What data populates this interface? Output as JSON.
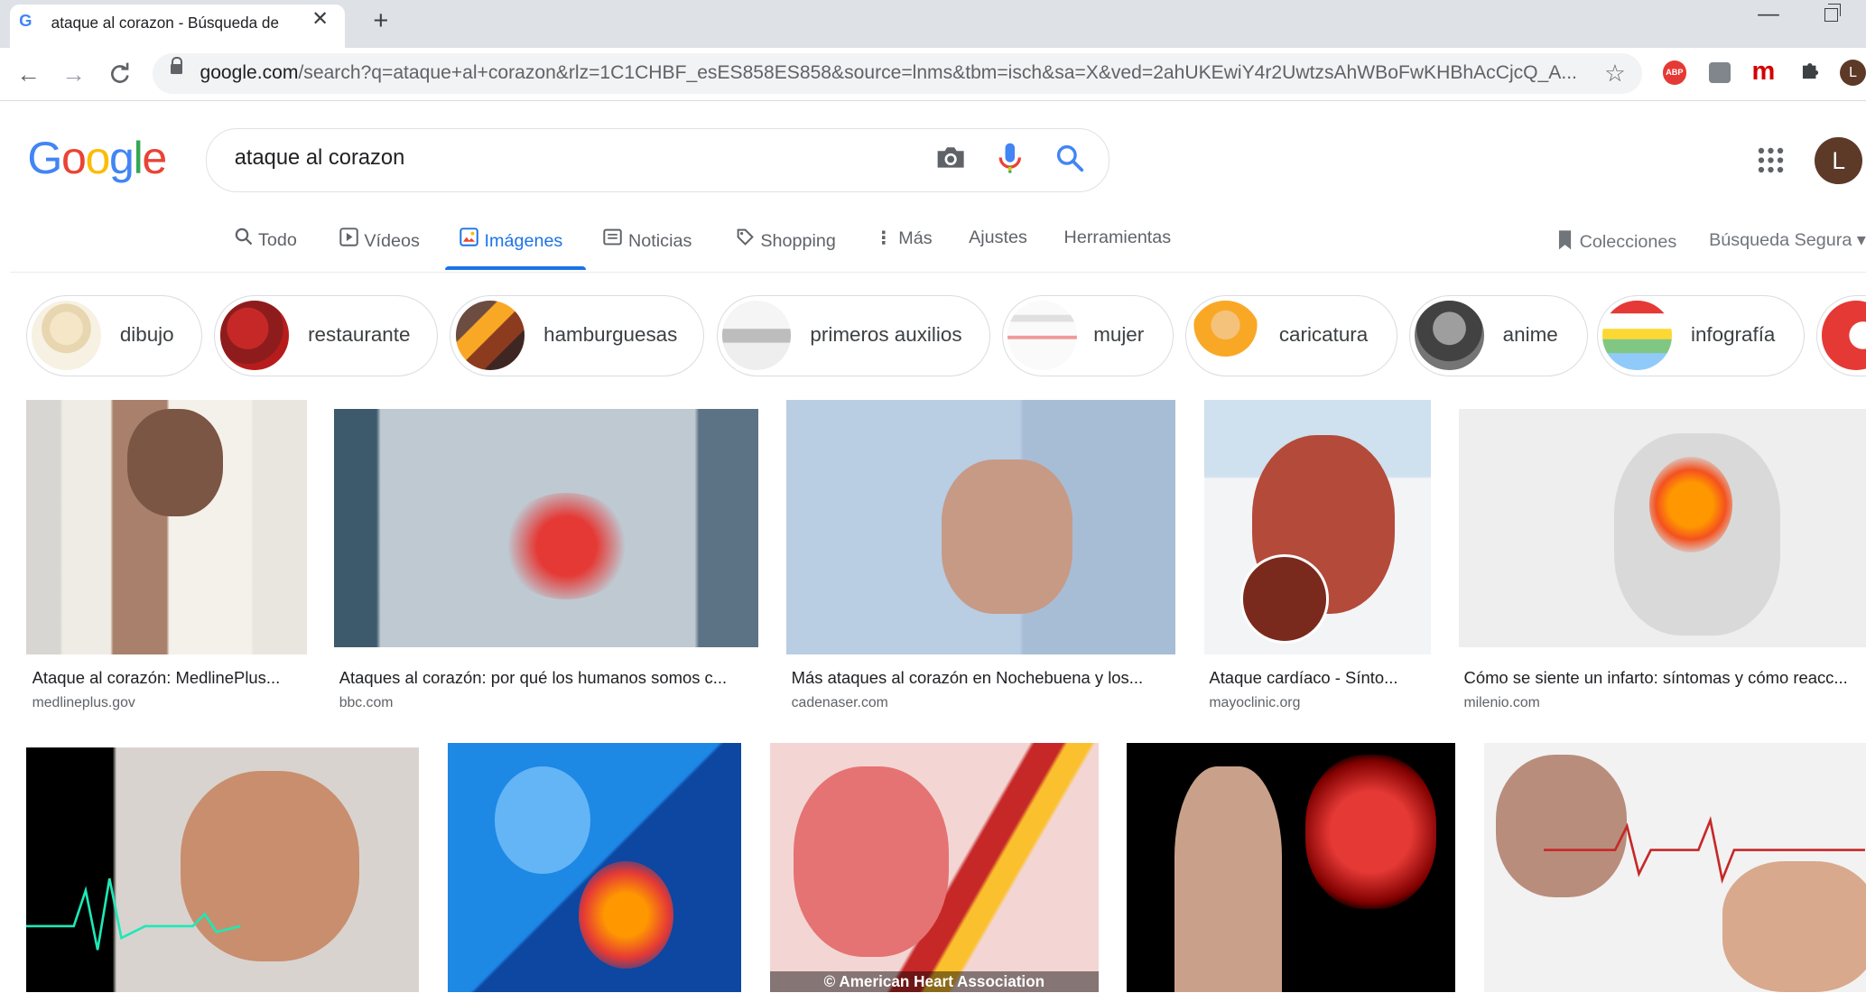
{
  "browser": {
    "tab_title": "ataque al corazon - Búsqueda de",
    "tab_favicon": "G",
    "new_tab": "+",
    "close_tab": "✕",
    "url_domain": "google.com",
    "url_rest": "/search?q=ataque+al+corazon&rlz=1C1CHBF_esES858ES858&source=lnms&tbm=isch&sa=X&ved=2ahUKEwiY4r2UwtzsAhWBoFwKHBhAcCjcQ_A...",
    "profile_initial": "L",
    "extensions": [
      "abp-icon",
      "hat-icon",
      "m-icon",
      "puzzle-icon"
    ]
  },
  "google": {
    "logo": [
      "G",
      "o",
      "o",
      "g",
      "l",
      "e"
    ],
    "logo_colors": [
      "#4285f4",
      "#ea4335",
      "#fbbc05",
      "#4285f4",
      "#34a853",
      "#ea4335"
    ],
    "query": "ataque al corazon",
    "avatar_initial": "L",
    "tabs": [
      {
        "label": "Todo",
        "icon": "search-icon"
      },
      {
        "label": "Vídeos",
        "icon": "play-icon"
      },
      {
        "label": "Imágenes",
        "icon": "image-icon",
        "active": true
      },
      {
        "label": "Noticias",
        "icon": "news-icon"
      },
      {
        "label": "Shopping",
        "icon": "tag-icon"
      },
      {
        "label": "Más",
        "icon": "more-vert-icon"
      }
    ],
    "settings": "Ajustes",
    "tools": "Herramientas",
    "collections": "Colecciones",
    "safe_search": "Búsqueda Segura ▾",
    "accent": "#1a73e8"
  },
  "chips": [
    "dibujo",
    "restaurante",
    "hamburguesas",
    "primeros auxilios",
    "mujer",
    "caricatura",
    "anime",
    "infografía"
  ],
  "results_row1": [
    {
      "caption": "Ataque al corazón: MedlinePlus...",
      "source": "medlineplus.gov"
    },
    {
      "caption": "Ataques al corazón: por qué los humanos somos c...",
      "source": "bbc.com"
    },
    {
      "caption": "Más ataques al corazón en Nochebuena y los...",
      "source": "cadenaser.com"
    },
    {
      "caption": "Ataque cardíaco - Sínto...",
      "source": "mayoclinic.org"
    },
    {
      "caption": "Cómo se siente un infarto: síntomas y cómo reacc...",
      "source": "milenio.com"
    }
  ],
  "results_row2": [
    {
      "overlay": ""
    },
    {
      "overlay": ""
    },
    {
      "overlay": "© American Heart Association"
    },
    {
      "overlay": ""
    },
    {
      "overlay": ""
    }
  ]
}
